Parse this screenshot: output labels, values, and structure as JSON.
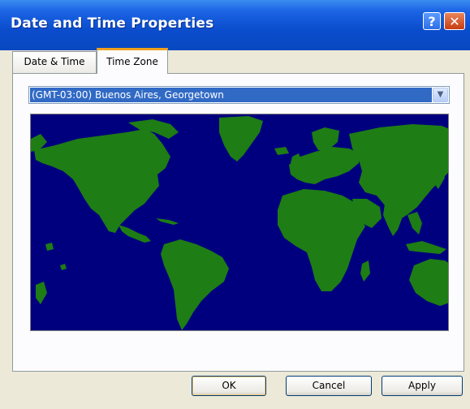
{
  "window": {
    "title": "Date and Time Properties",
    "help_label": "?",
    "close_label": "✕"
  },
  "tabs": [
    {
      "label": "Date & Time",
      "active": false
    },
    {
      "label": "Time Zone",
      "active": true
    }
  ],
  "timezone": {
    "selected": "(GMT-03:00) Buenos Aires, Georgetown",
    "dropdown_icon": "chevron-down-icon"
  },
  "map": {
    "ocean_color": "#00007f",
    "land_color": "#1e7d14"
  },
  "buttons": {
    "ok": "OK",
    "cancel": "Cancel",
    "apply": "Apply"
  }
}
